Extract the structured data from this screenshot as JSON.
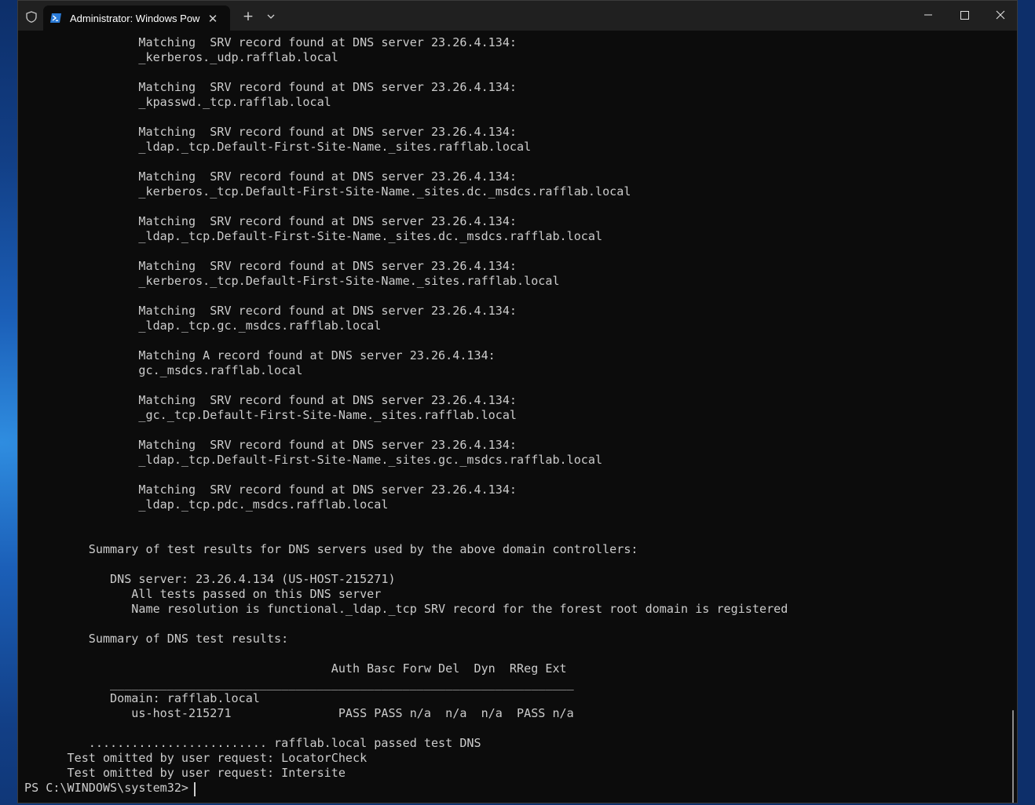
{
  "window": {
    "tab_title": "Administrator: Windows PowerShell",
    "tab_close": "✕",
    "new_tab": "+"
  },
  "console": {
    "lines": [
      "                Matching  SRV record found at DNS server 23.26.4.134:",
      "                _kerberos._udp.rafflab.local",
      "",
      "                Matching  SRV record found at DNS server 23.26.4.134:",
      "                _kpasswd._tcp.rafflab.local",
      "",
      "                Matching  SRV record found at DNS server 23.26.4.134:",
      "                _ldap._tcp.Default-First-Site-Name._sites.rafflab.local",
      "",
      "                Matching  SRV record found at DNS server 23.26.4.134:",
      "                _kerberos._tcp.Default-First-Site-Name._sites.dc._msdcs.rafflab.local",
      "",
      "                Matching  SRV record found at DNS server 23.26.4.134:",
      "                _ldap._tcp.Default-First-Site-Name._sites.dc._msdcs.rafflab.local",
      "",
      "                Matching  SRV record found at DNS server 23.26.4.134:",
      "                _kerberos._tcp.Default-First-Site-Name._sites.rafflab.local",
      "",
      "                Matching  SRV record found at DNS server 23.26.4.134:",
      "                _ldap._tcp.gc._msdcs.rafflab.local",
      "",
      "                Matching A record found at DNS server 23.26.4.134:",
      "                gc._msdcs.rafflab.local",
      "",
      "                Matching  SRV record found at DNS server 23.26.4.134:",
      "                _gc._tcp.Default-First-Site-Name._sites.rafflab.local",
      "",
      "                Matching  SRV record found at DNS server 23.26.4.134:",
      "                _ldap._tcp.Default-First-Site-Name._sites.gc._msdcs.rafflab.local",
      "",
      "                Matching  SRV record found at DNS server 23.26.4.134:",
      "                _ldap._tcp.pdc._msdcs.rafflab.local",
      "",
      "",
      "         Summary of test results for DNS servers used by the above domain controllers:",
      "",
      "            DNS server: 23.26.4.134 (US-HOST-215271)",
      "               All tests passed on this DNS server",
      "               Name resolution is functional._ldap._tcp SRV record for the forest root domain is registered",
      "",
      "         Summary of DNS test results:",
      "",
      "                                           Auth Basc Forw Del  Dyn  RReg Ext",
      "            _________________________________________________________________",
      "            Domain: rafflab.local",
      "               us-host-215271               PASS PASS n/a  n/a  n/a  PASS n/a",
      "",
      "         ......................... rafflab.local passed test DNS",
      "      Test omitted by user request: LocatorCheck",
      "      Test omitted by user request: Intersite",
      "PS C:\\WINDOWS\\system32> "
    ]
  }
}
